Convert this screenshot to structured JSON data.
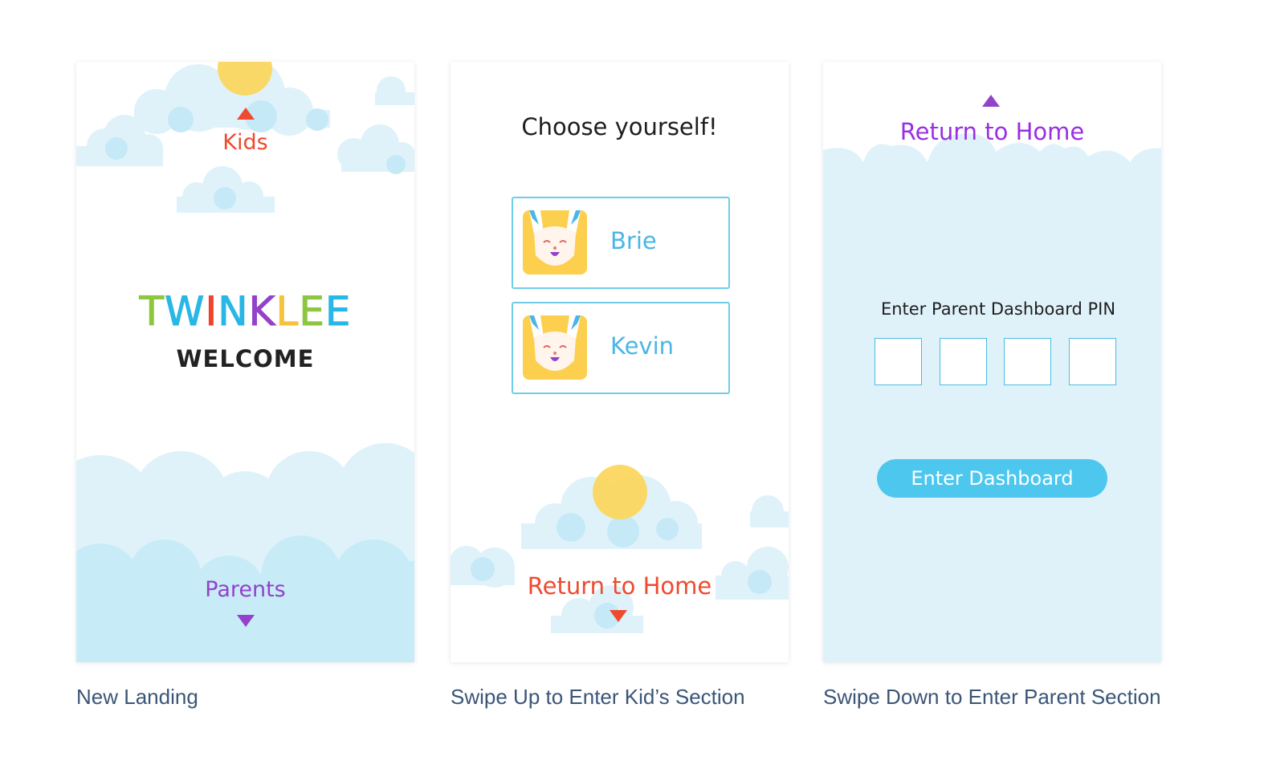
{
  "landing": {
    "kids_label": "Kids",
    "logo_letters": [
      {
        "char": "T",
        "color": "#8dc63f"
      },
      {
        "char": "W",
        "color": "#29b7e5"
      },
      {
        "char": "I",
        "color": "#f0432c"
      },
      {
        "char": "N",
        "color": "#29b7e5"
      },
      {
        "char": "K",
        "color": "#9342c9"
      },
      {
        "char": "L",
        "color": "#f6c23a"
      },
      {
        "char": "E",
        "color": "#8dc63f"
      },
      {
        "char": "E",
        "color": "#29b7e5"
      }
    ],
    "welcome": "WELCOME",
    "parents_label": "Parents",
    "caption": "New Landing"
  },
  "kids": {
    "title": "Choose yourself!",
    "profiles": [
      {
        "name": "Brie",
        "avatar_icon": "bunny-icon"
      },
      {
        "name": "Kevin",
        "avatar_icon": "bunny-icon"
      }
    ],
    "return_label": "Return to Home",
    "caption": "Swipe Up to Enter Kid’s Section"
  },
  "parents": {
    "return_label": "Return to Home",
    "pin_label": "Enter Parent Dashboard PIN",
    "pin_values": [
      "",
      "",
      "",
      ""
    ],
    "button_label": "Enter Dashboard",
    "caption": "Swipe Down to Enter Parent Section"
  },
  "colors": {
    "kids_accent": "#ef4a2f",
    "parents_accent": "#9342c9",
    "sky_blue": "#4ec7ee",
    "cloud_light": "#dff2fa",
    "sun": "#fcd65a"
  }
}
